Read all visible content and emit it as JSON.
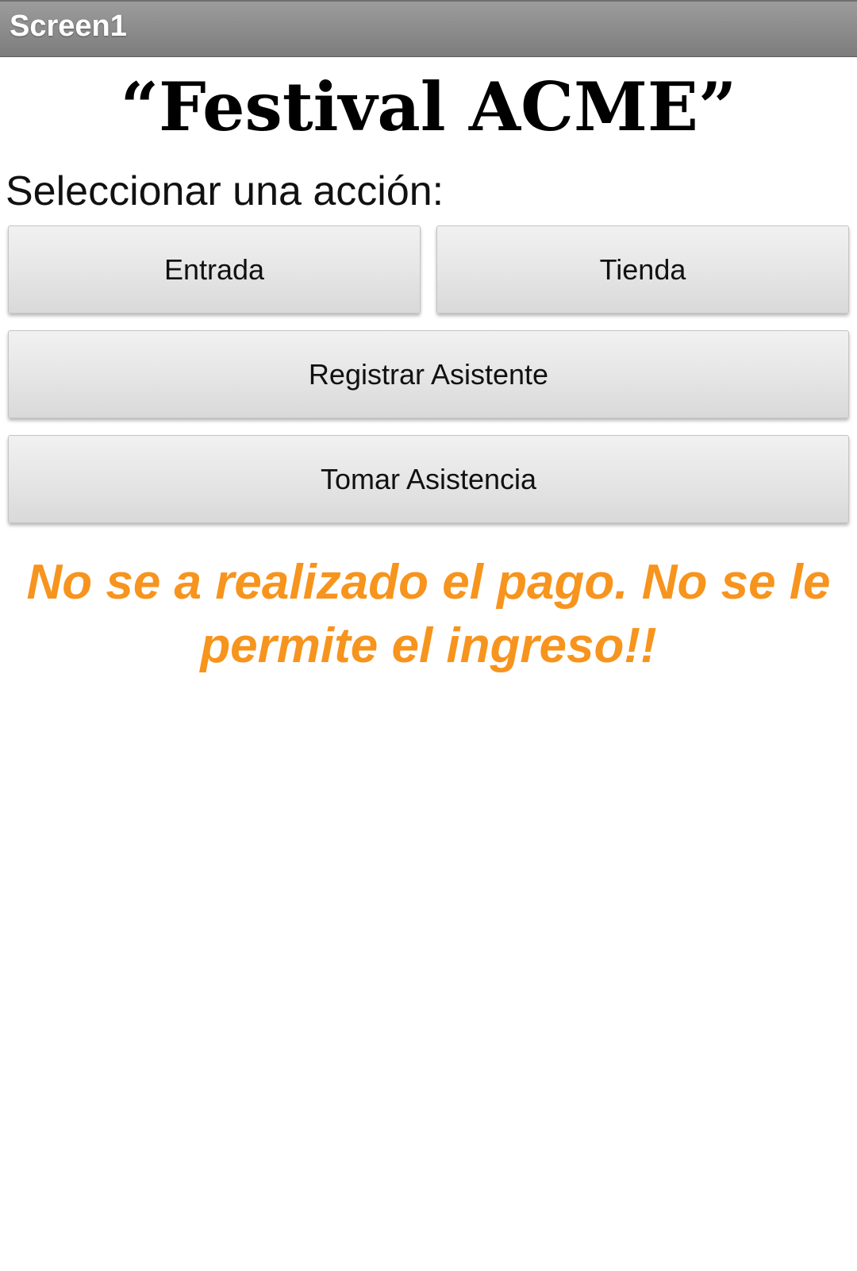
{
  "app": {
    "screen_title": "Screen1"
  },
  "main": {
    "title": "“Festival ACME”",
    "prompt": "Seleccionar una acción:",
    "buttons": {
      "entrada": "Entrada",
      "tienda": "Tienda",
      "registrar": "Registrar Asistente",
      "tomar": "Tomar Asistencia"
    },
    "status_message": "No se a realizado el pago. No se le permite el ingreso!!"
  },
  "colors": {
    "titlebar": "#8b8b8b",
    "status_text": "#f7941d",
    "button_face": "#e6e6e6"
  }
}
